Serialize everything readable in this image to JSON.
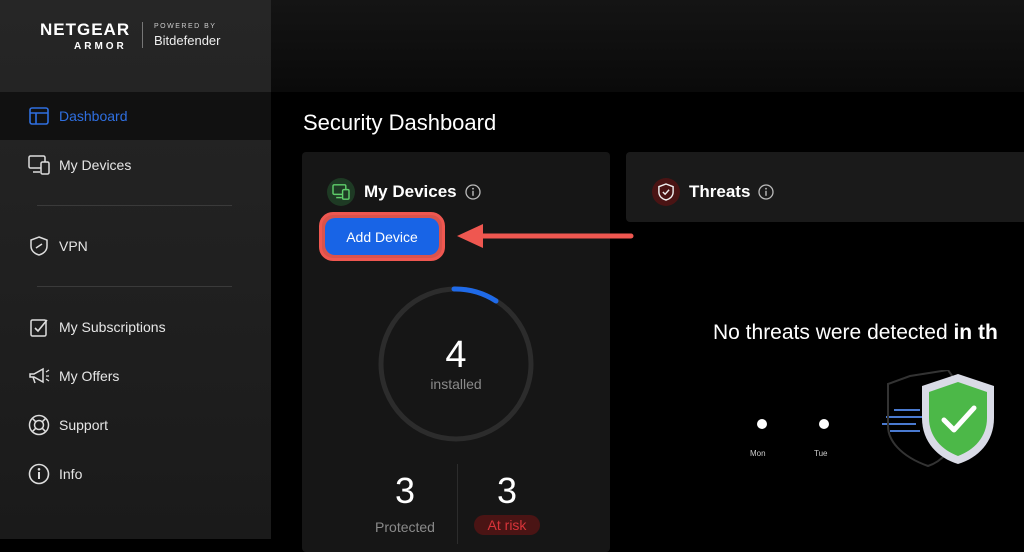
{
  "brand": {
    "name": "NETGEAR",
    "product": "ARMOR",
    "powered_by": "POWERED BY",
    "partner": "Bitdefender"
  },
  "sidebar": {
    "items": [
      {
        "label": "Dashboard",
        "icon": "dashboard-icon",
        "active": true
      },
      {
        "label": "My Devices",
        "icon": "devices-icon"
      },
      {
        "label": "VPN",
        "icon": "vpn-shield-icon"
      },
      {
        "label": "My Subscriptions",
        "icon": "subscriptions-icon"
      },
      {
        "label": "My Offers",
        "icon": "megaphone-icon"
      },
      {
        "label": "Support",
        "icon": "lifebuoy-icon"
      },
      {
        "label": "Info",
        "icon": "info-icon"
      }
    ]
  },
  "page": {
    "title": "Security Dashboard"
  },
  "devices_card": {
    "title": "My Devices",
    "add_button": "Add Device",
    "installed_count": "4",
    "installed_label": "installed",
    "protected_count": "3",
    "protected_label": "Protected",
    "at_risk_count": "3",
    "at_risk_label": "At risk"
  },
  "threats_card": {
    "title": "Threats",
    "message_plain": "No threats were detected ",
    "message_bold": "in th",
    "timeline_days": [
      "Mon",
      "Tue"
    ]
  },
  "colors": {
    "accent_blue": "#1864e6",
    "highlight_red": "#ef5750",
    "risk_red": "#d9343a",
    "device_badge_green": "#1e3a24",
    "threat_badge_red": "#4a1414"
  }
}
